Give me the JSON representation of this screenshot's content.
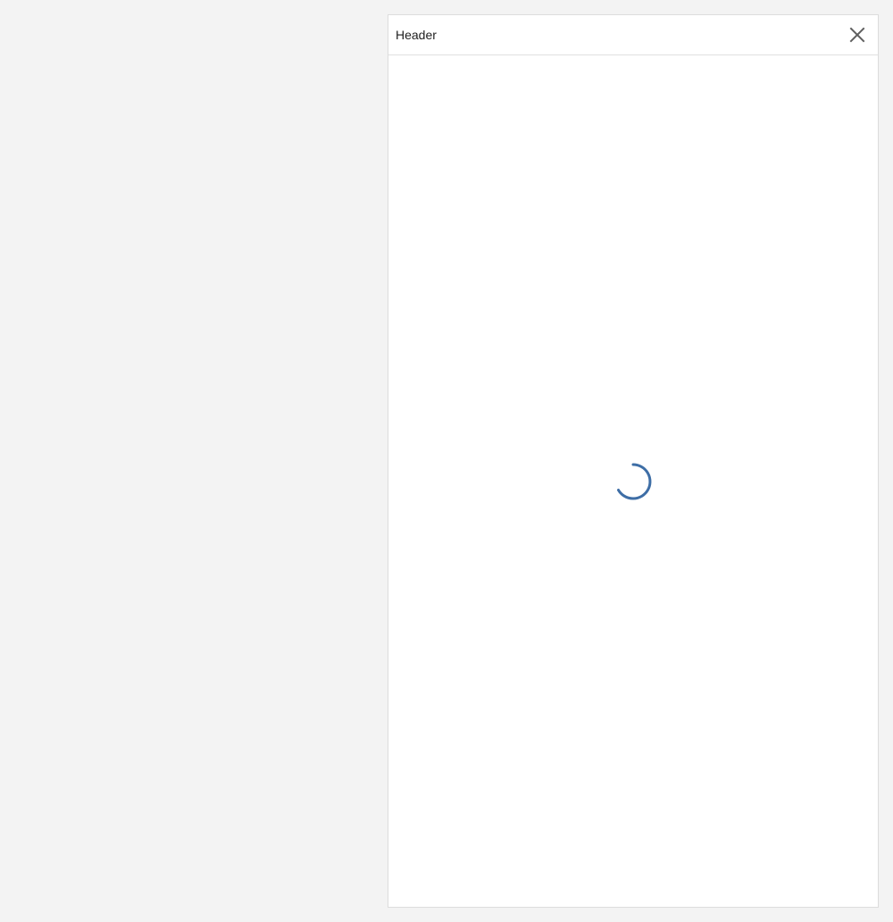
{
  "panel": {
    "title": "Header",
    "close_icon": "close-icon"
  },
  "loading": {
    "indicator_icon": "spinner-icon",
    "color": "#3e6ea6"
  },
  "colors": {
    "page_background": "#f3f3f3",
    "panel_background": "#ffffff",
    "panel_border": "#dcdcdc",
    "close_icon": "#5f5f5f"
  }
}
